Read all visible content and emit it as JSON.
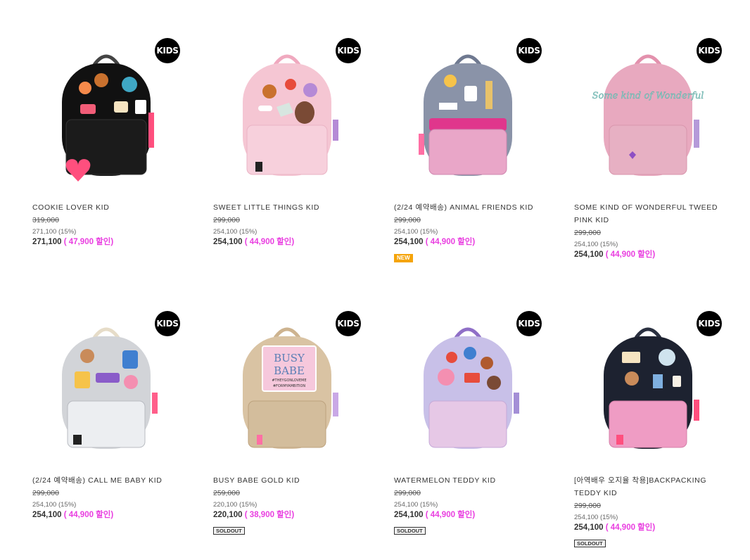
{
  "products": [
    {
      "name": "COOKIE LOVER KID",
      "name2": "",
      "badge": "KIDS",
      "original": "319,000",
      "member": "271,100 (15%)",
      "price": "271,100",
      "discount": "( 47,900 할인)",
      "tag": "",
      "colors": {
        "body": "#111111",
        "strap": "#333333",
        "pocket": "#1a1a1a",
        "accent": "#ff4f7e"
      }
    },
    {
      "name": "SWEET LITTLE THINGS KID",
      "name2": "",
      "badge": "KIDS",
      "original": "299,000",
      "member": "254,100 (15%)",
      "price": "254,100",
      "discount": "( 44,900 할인)",
      "tag": "",
      "colors": {
        "body": "#f5c6d3",
        "strap": "#f0a9bf",
        "pocket": "#f7cfda",
        "accent": "#b58ad6"
      }
    },
    {
      "name": "(2/24 예약배송) ANIMAL FRIENDS KID",
      "name2": "",
      "badge": "KIDS",
      "original": "299,000",
      "member": "254,100 (15%)",
      "price": "254,100",
      "discount": "( 44,900 할인)",
      "tag": "NEW",
      "colors": {
        "body": "#8a93a8",
        "strap": "#6f7990",
        "pocket": "#e9a6c8",
        "accent": "#e0368c"
      }
    },
    {
      "name": "SOME KIND OF WONDERFUL TWEED",
      "name2": "PINK KID",
      "badge": "KIDS",
      "original": "299,000",
      "member": "254,100 (15%)",
      "price": "254,100",
      "discount": "( 44,900 할인)",
      "tag": "",
      "colors": {
        "body": "#e8a9bf",
        "strap": "#e391ad",
        "pocket": "#e7b0c3",
        "accent": "#8fd1cc"
      }
    },
    {
      "name": "(2/24 예약배송) CALL ME BABY KID",
      "name2": "",
      "badge": "KIDS",
      "original": "299,000",
      "member": "254,100 (15%)",
      "price": "254,100",
      "discount": "( 44,900 할인)",
      "tag": "",
      "colors": {
        "body": "#d2d4d8",
        "strap": "#e6dcc8",
        "pocket": "#e8e9ec",
        "accent": "#ff5e8a"
      }
    },
    {
      "name": "BUSY BABE GOLD KID",
      "name2": "",
      "badge": "KIDS",
      "original": "259,000",
      "member": "220,100 (15%)",
      "price": "220,100",
      "discount": "( 38,900 할인)",
      "tag": "SOLDOUT",
      "colors": {
        "body": "#d9c3a3",
        "strap": "#cdb38f",
        "pocket": "#d3bd9c",
        "accent": "#f6c8dc"
      }
    },
    {
      "name": "WATERMELON TEDDY KID",
      "name2": "",
      "badge": "KIDS",
      "original": "299,000",
      "member": "254,100 (15%)",
      "price": "254,100",
      "discount": "( 44,900 할인)",
      "tag": "SOLDOUT",
      "colors": {
        "body": "#c8c0e8",
        "strap": "#8f6fc7",
        "pocket": "#e6c8e6",
        "accent": "#f48fb1"
      }
    },
    {
      "name": "[아역배우 오지율 착용]BACKPACKING",
      "name2": "TEDDY KID",
      "badge": "KIDS",
      "original": "299,000",
      "member": "254,100 (15%)",
      "price": "254,100",
      "discount": "( 44,900 할인)",
      "tag": "SOLDOUT",
      "colors": {
        "body": "#1d2230",
        "strap": "#2a3040",
        "pocket": "#ef9cc4",
        "accent": "#ff4f7e"
      }
    }
  ],
  "bag_texts": {
    "tweed": "Some kind of Wonderful",
    "busy_line1": "BUSY",
    "busy_line2": "BABE",
    "busy_line3": "#THEYGONLOVEME",
    "busy_line4": "#FORMYAMBITION"
  }
}
